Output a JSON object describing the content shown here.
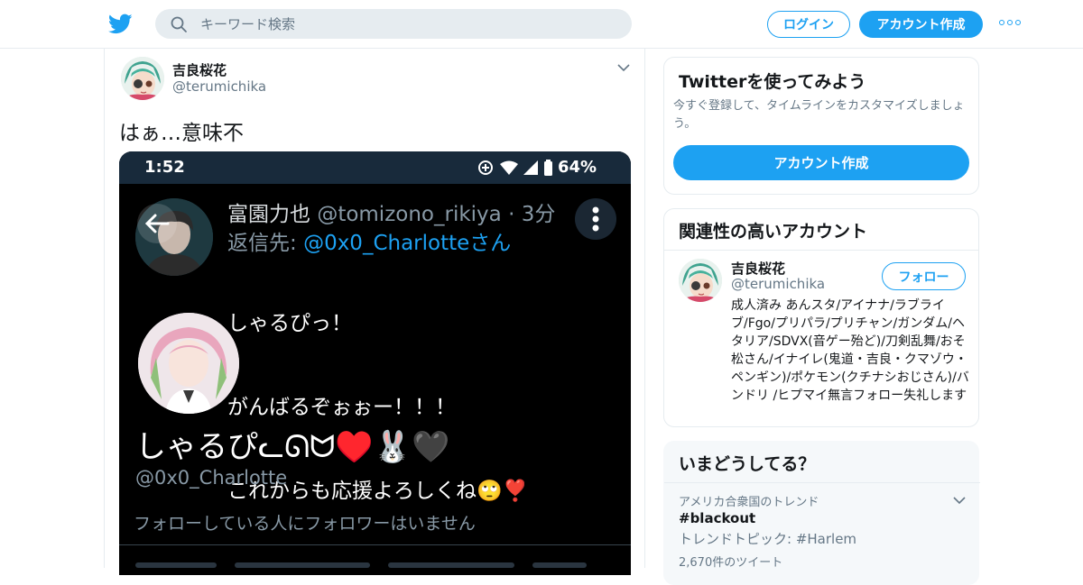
{
  "header": {
    "logo": "twitter-bird-icon",
    "search": {
      "placeholder": "キーワード検索",
      "value": ""
    },
    "login_label": "ログイン",
    "signup_label": "アカウント作成",
    "brand_color": "#1da1f2"
  },
  "tweet": {
    "author_name": "吉良桜花",
    "author_handle": "@terumichika",
    "text": "はぁ…意味不",
    "screenshot": {
      "status_time": "1:52",
      "status_battery": "64%",
      "reply_author": "富園力也",
      "reply_handle": "@tomizono_rikiya",
      "reply_age": "· 3分",
      "reply_to_label": "返信先:",
      "reply_to_mention": "@0x0_Charlotteさん",
      "reply_lines": [
        "しゃるぴっ！",
        "がんばるぞぉぉー！！！",
        "これからも応援よろしくね🙄❣️"
      ],
      "profile_display_name": "しゃるぴᓚᘏᗢ♥️🐰🖤",
      "profile_handle": "@0x0_Charlotte",
      "no_followers_note": "フォローしている人にフォロワーはいません"
    }
  },
  "sidebar": {
    "try_card": {
      "title": "Twitterを使ってみよう",
      "description": "今すぐ登録して、タイムラインをカスタマイズしましょう。",
      "button_label": "アカウント作成"
    },
    "related_card": {
      "title": "関連性の高いアカウント",
      "account": {
        "name": "吉良桜花",
        "handle": "@terumichika",
        "follow_label": "フォロー",
        "bio": "成人済み あんスタ/アイナナ/ラブライブ/Fgo/プリパラ/プリチャン/ガンダム/ヘタリア/SDVX(音ゲー殆ど)/刀剣乱舞/おそ松さん/イナイレ(鬼道・吉良・クマゾウ・ペンギン)/ポケモン(クチナシおじさん)/バンドリ /ヒプマイ無言フォロー失礼します"
      }
    },
    "trends_card": {
      "title": "いまどうしてる？",
      "trend": {
        "meta": "アメリカ合衆国のトレンド",
        "name": "#blackout",
        "topic": "トレンドトピック: #Harlem",
        "count": "2,670件のツイート"
      }
    }
  }
}
